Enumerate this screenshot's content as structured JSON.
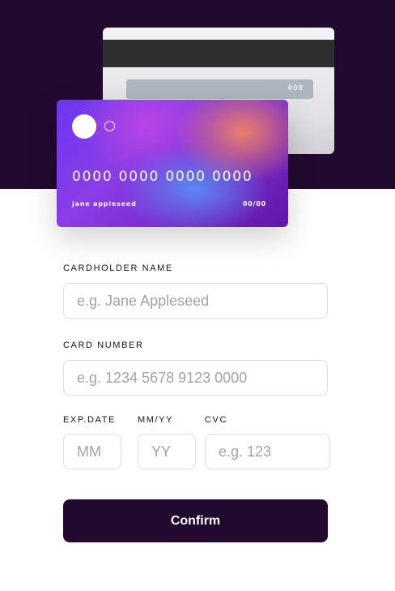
{
  "card_back": {
    "cvc": "000"
  },
  "card_front": {
    "number": "0000 0000 0000 0000",
    "name": "jane appleseed",
    "expiry": "00/00"
  },
  "form": {
    "cardholder": {
      "label": "CARDHOLDER NAME",
      "placeholder": "e.g. Jane Appleseed"
    },
    "card_number": {
      "label": "CARD NUMBER",
      "placeholder": "e.g. 1234 5678 9123 0000"
    },
    "exp_date_label": "EXP.DATE",
    "mm_yy_label": "MM/YY",
    "cvc_label": "CVC",
    "month_placeholder": "MM",
    "year_placeholder": "YY",
    "cvc_placeholder": "e.g. 123",
    "confirm_label": "Confirm"
  },
  "colors": {
    "dark_violet": "#21092f",
    "input_border": "#dedddf",
    "placeholder": "#a4a1a9"
  }
}
